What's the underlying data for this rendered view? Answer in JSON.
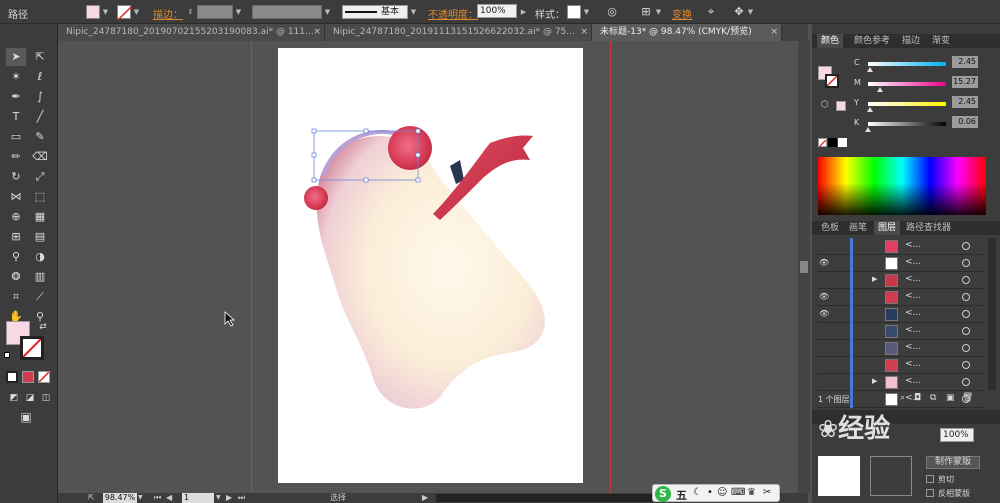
{
  "control_bar": {
    "object_type": "路径",
    "stroke_label": "描边：",
    "stroke_style": "基本",
    "opacity_label": "不透明度：",
    "opacity_value": "100%",
    "style_label": "样式：",
    "transform_label": "变换",
    "fill_color": "#f8d8e4"
  },
  "tabs": [
    {
      "label": "Nipic_24787180_20190702155203190083.ai* @ 111...",
      "close": "×"
    },
    {
      "label": "Nipic_24787180_20191113151526622032.ai* @ 75...",
      "close": "×"
    },
    {
      "label": "未标题-13* @ 98.47% (CMYK/预览)",
      "close": "×"
    }
  ],
  "status_bar": {
    "zoom": "98.47%",
    "page": "1",
    "mode": "选择"
  },
  "color_panel": {
    "tabs": [
      "颜色",
      "颜色参考",
      "描边",
      "渐变"
    ],
    "channels": [
      {
        "name": "C",
        "value": "2.45",
        "level": 0.0245,
        "gradient": "linear-gradient(to right,#ffffff,#00aeef)"
      },
      {
        "name": "M",
        "value": "15.27",
        "level": 0.1527,
        "gradient": "linear-gradient(to right,#ffffff,#ec008c)"
      },
      {
        "name": "Y",
        "value": "2.45",
        "level": 0.0245,
        "gradient": "linear-gradient(to right,#ffffff,#fff200)"
      },
      {
        "name": "K",
        "value": "0.06",
        "level": 0.0006,
        "gradient": "linear-gradient(to right,#ffffff,#000000)"
      }
    ]
  },
  "layers_panel": {
    "tabs": [
      "色板",
      "画笔",
      "图层",
      "路径查找器"
    ],
    "count_label": "1 个图层",
    "rows": [
      {
        "eye": "",
        "arrow": "",
        "name": "<...",
        "thumb": "#e04060"
      },
      {
        "eye": "👁",
        "arrow": "",
        "name": "<...",
        "thumb": "#ffffff"
      },
      {
        "eye": "",
        "arrow": "▶",
        "name": "<...",
        "thumb": "#c83a4a"
      },
      {
        "eye": "👁",
        "arrow": "",
        "name": "<...",
        "thumb": "#d03b50"
      },
      {
        "eye": "👁",
        "arrow": "",
        "name": "<...",
        "thumb": "#2a3a5a"
      },
      {
        "eye": "",
        "arrow": "",
        "name": "<...",
        "thumb": "#3a4a6a"
      },
      {
        "eye": "",
        "arrow": "",
        "name": "<...",
        "thumb": "#5a5a7a"
      },
      {
        "eye": "",
        "arrow": "",
        "name": "<...",
        "thumb": "#d04050"
      },
      {
        "eye": "",
        "arrow": "▶",
        "name": "<...",
        "thumb": "#f0c0d0"
      },
      {
        "eye": "",
        "arrow": "",
        "name": "<...",
        "thumb": "#ffffff"
      }
    ]
  },
  "transparency_panel": {
    "opacity_value": "100%",
    "make_mask_label": "制作蒙版",
    "clip_label": "剪切",
    "invert_label": "反相蒙版"
  },
  "taskbar": {
    "ime_label": "五",
    "ime_icon": "S"
  },
  "watermark": {
    "text": "经验"
  }
}
